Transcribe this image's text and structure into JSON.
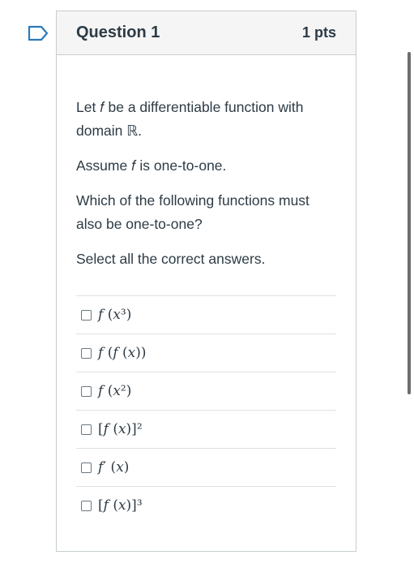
{
  "question": {
    "title": "Question 1",
    "points": "1 pts",
    "paragraphs": [
      "Let 𝑓 be a differentiable function with domain ℝ.",
      "Assume 𝑓 is one-to-one.",
      "Which of the following functions must also be one-to-one?",
      "Select all the correct answers."
    ],
    "answers": [
      {
        "label": "𝑓 (𝑥³)",
        "checked": false
      },
      {
        "label": "𝑓 (𝑓 (𝑥))",
        "checked": false
      },
      {
        "label": "𝑓 (𝑥²)",
        "checked": false
      },
      {
        "label": "[𝑓 (𝑥)]²",
        "checked": false
      },
      {
        "label": "𝑓′ (𝑥)",
        "checked": false
      },
      {
        "label": "[𝑓 (𝑥)]³",
        "checked": false
      }
    ]
  },
  "icons": {
    "flag": "flag-bookmark-icon"
  },
  "colors": {
    "flag_border": "#2b7abc",
    "header_bg": "#f5f5f5",
    "text": "#2d3b45"
  }
}
